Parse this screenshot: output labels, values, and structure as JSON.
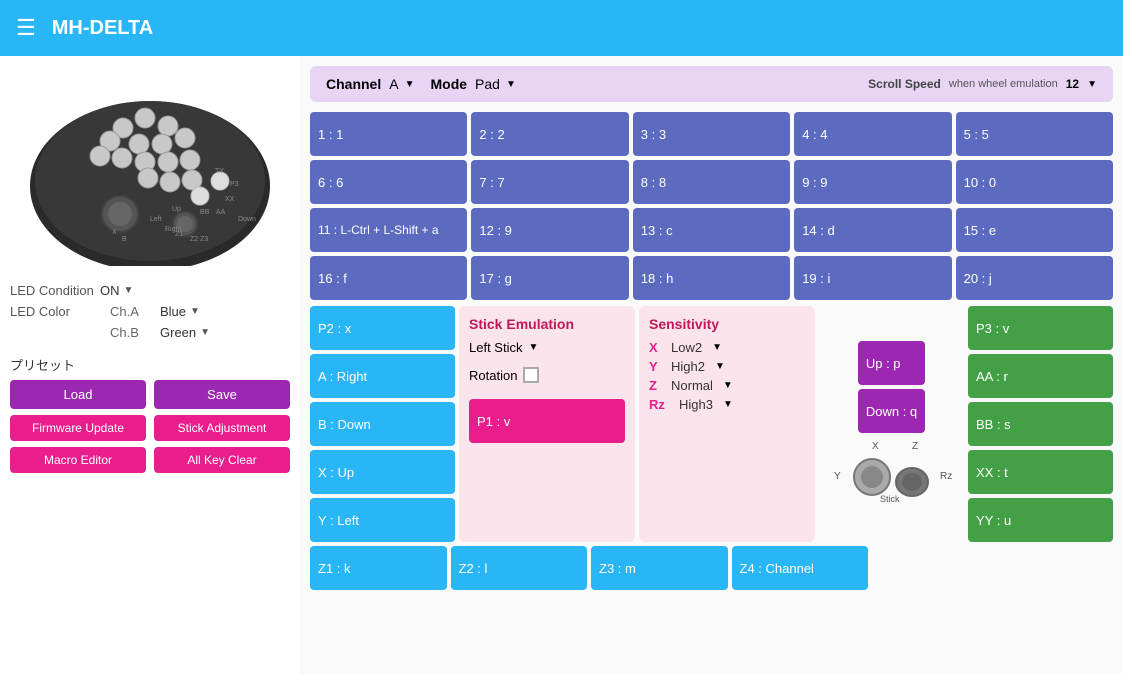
{
  "header": {
    "title": "MH-DELTA",
    "menu_icon": "☰"
  },
  "channel_bar": {
    "channel_label": "Channel",
    "channel_value": "A",
    "mode_label": "Mode",
    "mode_value": "Pad",
    "scroll_speed_label": "Scroll Speed",
    "scroll_speed_sub": "when wheel emulation",
    "scroll_speed_value": "12"
  },
  "keys": {
    "row1": [
      {
        "id": "1",
        "label": "1 : 1"
      },
      {
        "id": "2",
        "label": "2 : 2"
      },
      {
        "id": "3",
        "label": "3 : 3"
      },
      {
        "id": "4",
        "label": "4 : 4"
      },
      {
        "id": "5",
        "label": "5 : 5"
      }
    ],
    "row2": [
      {
        "id": "6",
        "label": "6 : 6"
      },
      {
        "id": "7",
        "label": "7 : 7"
      },
      {
        "id": "8",
        "label": "8 : 8"
      },
      {
        "id": "9",
        "label": "9 : 9"
      },
      {
        "id": "10",
        "label": "10 : 0"
      }
    ],
    "row3": [
      {
        "id": "11",
        "label": "11 : L-Ctrl + L-Shift + a"
      },
      {
        "id": "12",
        "label": "12 : 9"
      },
      {
        "id": "13",
        "label": "13 : c"
      },
      {
        "id": "14",
        "label": "14 : d"
      },
      {
        "id": "15",
        "label": "15 : e"
      }
    ],
    "row4": [
      {
        "id": "16",
        "label": "16 : f"
      },
      {
        "id": "17",
        "label": "17 : g"
      },
      {
        "id": "18",
        "label": "18 : h"
      },
      {
        "id": "19",
        "label": "19 : i"
      },
      {
        "id": "20",
        "label": "20 : j"
      }
    ]
  },
  "left_side_keys": [
    {
      "id": "P2",
      "label": "P2 : x",
      "color": "blue"
    },
    {
      "id": "A",
      "label": "A : Right",
      "color": "blue"
    },
    {
      "id": "B",
      "label": "B : Down",
      "color": "blue"
    },
    {
      "id": "X",
      "label": "X : Up",
      "color": "blue"
    },
    {
      "id": "Y",
      "label": "Y : Left",
      "color": "blue"
    }
  ],
  "stick_emulation": {
    "title": "Stick Emulation",
    "stick_label": "Left Stick",
    "rotation_label": "Rotation"
  },
  "sensitivity": {
    "title": "Sensitivity",
    "rows": [
      {
        "axis": "X",
        "value": "Low2"
      },
      {
        "axis": "Y",
        "value": "High2"
      },
      {
        "axis": "Z",
        "value": "Normal"
      },
      {
        "axis": "Rz",
        "value": "High3"
      }
    ]
  },
  "right_side_top_keys": [
    {
      "id": "Up",
      "label": "Up : p",
      "color": "purple"
    },
    {
      "id": "Down",
      "label": "Down : q",
      "color": "purple"
    }
  ],
  "right_side_green_keys": [
    {
      "id": "P3",
      "label": "P3 : v",
      "color": "green"
    },
    {
      "id": "AA",
      "label": "AA : r",
      "color": "green"
    },
    {
      "id": "BB",
      "label": "BB : s",
      "color": "green"
    },
    {
      "id": "XX",
      "label": "XX : t",
      "color": "green"
    },
    {
      "id": "YY",
      "label": "YY : u",
      "color": "green"
    }
  ],
  "bottom_keys": [
    {
      "id": "Z1",
      "label": "Z1 : k"
    },
    {
      "id": "Z2",
      "label": "Z2 : l"
    },
    {
      "id": "Z3",
      "label": "Z3 : m"
    },
    {
      "id": "Z4",
      "label": "Z4 : Channel"
    }
  ],
  "pink_key": {
    "id": "P1",
    "label": "P1 : v"
  },
  "led": {
    "condition_label": "LED Condition",
    "condition_value": "ON",
    "color_label": "LED Color",
    "ch_a_label": "Ch.A",
    "ch_a_value": "Blue",
    "ch_b_label": "Ch.B",
    "ch_b_value": "Green"
  },
  "preset": {
    "label": "プリセット",
    "load_btn": "Load",
    "save_btn": "Save",
    "firmware_btn": "Firmware Update",
    "stick_adj_btn": "Stick Adjustment",
    "macro_btn": "Macro Editor",
    "allkey_btn": "All Key Clear"
  }
}
